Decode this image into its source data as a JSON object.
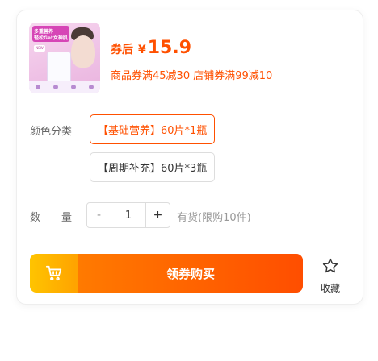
{
  "product": {
    "thumb_line1": "多重营养",
    "thumb_line2": "轻松Get女神肌",
    "thumb_badge": "NEW"
  },
  "price": {
    "prefix": "券后",
    "currency": "¥",
    "value": "15.9",
    "color": "#ff5000"
  },
  "coupon_text": "商品券满45减30 店铺券满99减10",
  "options": {
    "label": "颜色分类",
    "items": [
      {
        "label": "【基础营养】60片*1瓶",
        "selected": true
      },
      {
        "label": "【周期补充】60片*3瓶",
        "selected": false
      }
    ]
  },
  "quantity": {
    "label": "数　　量",
    "minus": "-",
    "value": "1",
    "plus": "+",
    "stock": "有货(限购10件)"
  },
  "actions": {
    "cart_icon": "cart-icon",
    "buy_label": "领券购买",
    "fav_icon": "star-icon",
    "fav_label": "收藏"
  }
}
